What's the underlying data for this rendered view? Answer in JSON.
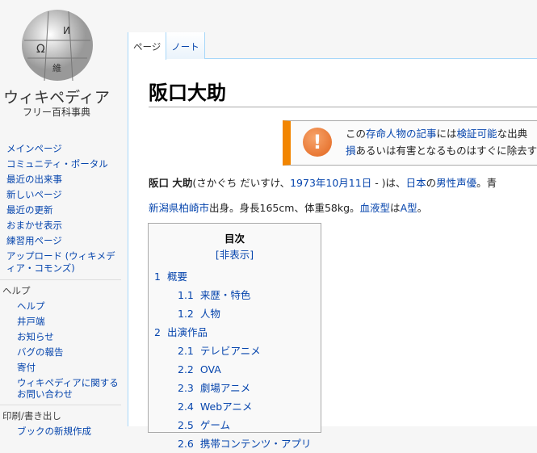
{
  "logo": {
    "title": "ウィキペディア",
    "subtitle": "フリー百科事典"
  },
  "sidebar": {
    "nav": [
      "メインページ",
      "コミュニティ・ポータル",
      "最近の出来事",
      "新しいページ",
      "最近の更新",
      "おまかせ表示",
      "練習用ページ",
      "アップロード (ウィキメディア・コモンズ)"
    ],
    "help_heading": "ヘルプ",
    "help": [
      "ヘルプ",
      "井戸端",
      "お知らせ",
      "バグの報告",
      "寄付",
      "ウィキペディアに関するお問い合わせ"
    ],
    "print_heading": "印刷/書き出し",
    "print": [
      "ブックの新規作成"
    ]
  },
  "tabs": [
    "ページ",
    "ノート"
  ],
  "title": "阪口大助",
  "notice": {
    "pre": "この",
    "l1": "存命人物の記事",
    "mid": "には",
    "l2": "検証可能",
    "post": "な出典",
    "line2a": "損",
    "line2b": "あるいは有害となるものはすぐに除去す"
  },
  "para1": {
    "name": "阪口 大助",
    "reading": "(さかぐち だいすけ、",
    "date": "1973年10月11日",
    "after": " - )は、",
    "l1": "日本",
    "no": "の",
    "l2": "男性声優",
    "end": "。青"
  },
  "para2": {
    "l1": "新潟県",
    "l2": "柏崎市",
    "t1": "出身。身長165cm、体重58kg。",
    "l3": "血液型",
    "t2": "は",
    "l4": "A型",
    "t3": "。"
  },
  "toc": {
    "heading": "目次",
    "toggle": "[非表示]",
    "items": [
      {
        "num": "1",
        "label": "概要",
        "level": 1
      },
      {
        "num": "1.1",
        "label": "来歴・特色",
        "level": 2
      },
      {
        "num": "1.2",
        "label": "人物",
        "level": 2
      },
      {
        "num": "2",
        "label": "出演作品",
        "level": 1
      },
      {
        "num": "2.1",
        "label": "テレビアニメ",
        "level": 2
      },
      {
        "num": "2.2",
        "label": "OVA",
        "level": 2
      },
      {
        "num": "2.3",
        "label": "劇場アニメ",
        "level": 2
      },
      {
        "num": "2.4",
        "label": "Webアニメ",
        "level": 2
      },
      {
        "num": "2.5",
        "label": "ゲーム",
        "level": 2
      },
      {
        "num": "2.6",
        "label": "携帯コンテンツ・アプリ",
        "level": 2
      }
    ]
  }
}
